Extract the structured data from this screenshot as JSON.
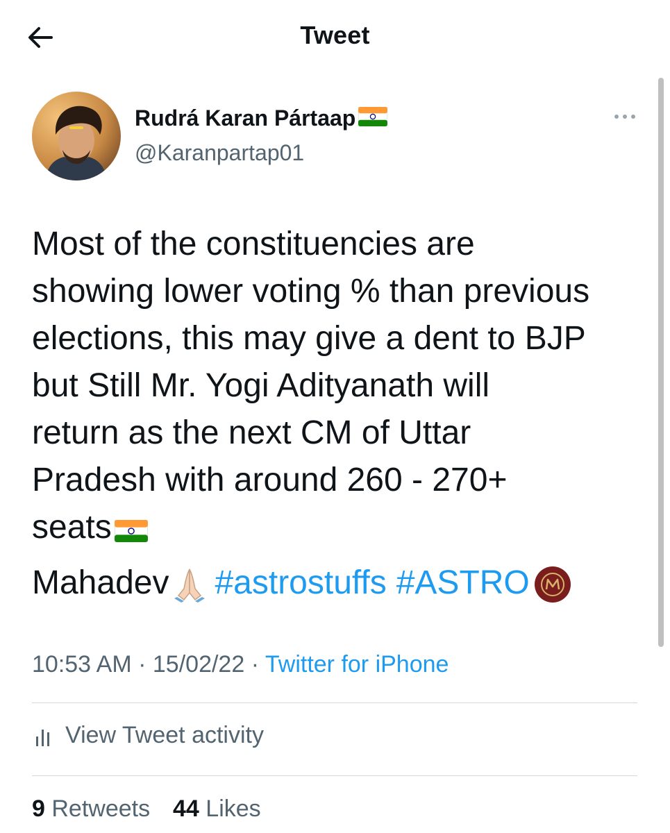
{
  "header": {
    "title": "Tweet",
    "back_icon": "arrow-left-icon"
  },
  "author": {
    "name": "Rudrá Karan Pártaap",
    "name_emoji": "india-flag-icon",
    "handle": "@Karanpartap01",
    "more_icon": "more-horizontal-icon"
  },
  "tweet": {
    "lines": [
      "Most of the constituencies are",
      "showing lower voting % than previous",
      "elections, this may give a dent to BJP",
      "but Still Mr. Yogi Adityanath will",
      "return as the next CM of Uttar",
      "Pradesh with around 260 - 270+",
      "seats"
    ],
    "signoff": "Mahadev",
    "hashtags": [
      "#astrostuffs",
      "#ASTRO"
    ]
  },
  "meta": {
    "time": "10:53 AM",
    "date": "15/02/22",
    "separator": "·",
    "source": "Twitter for iPhone"
  },
  "activity": {
    "label": "View Tweet activity",
    "icon": "bar-chart-icon"
  },
  "stats": {
    "retweets_count": "9",
    "retweets_label": "Retweets",
    "likes_count": "44",
    "likes_label": "Likes"
  },
  "colors": {
    "link": "#1d9bf0",
    "secondary": "#536471",
    "primary": "#0f1419",
    "divider": "#cfd9de"
  }
}
